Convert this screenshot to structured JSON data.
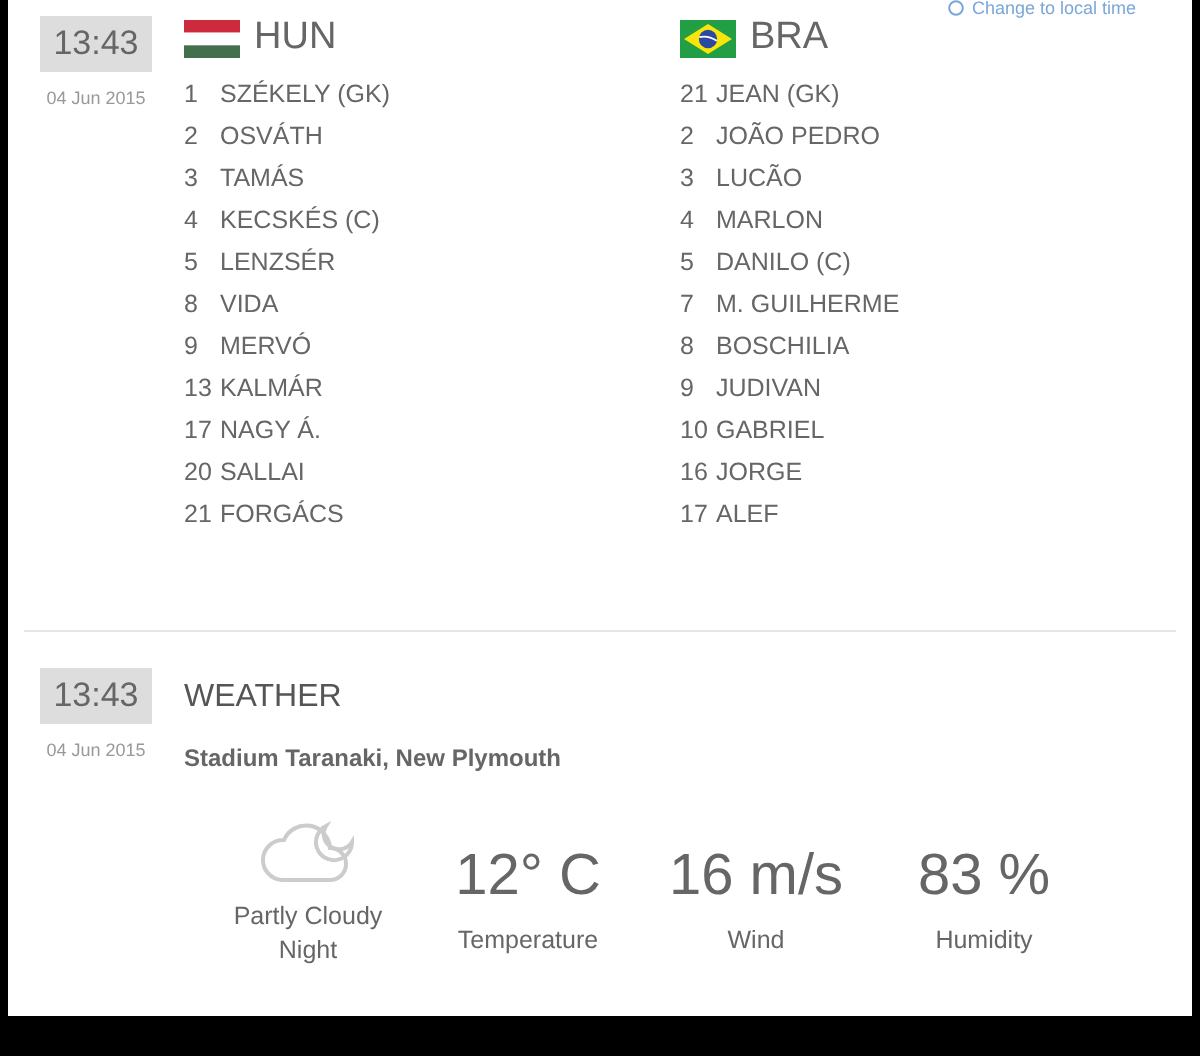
{
  "local_time_link": "Change to local time",
  "lineups": {
    "time": "13:43",
    "date": "04 Jun 2015",
    "teams": [
      {
        "code": "HUN",
        "kind": "hungary",
        "players": [
          {
            "number": "1",
            "name": "SZÉKELY (GK)"
          },
          {
            "number": "2",
            "name": "OSVÁTH"
          },
          {
            "number": "3",
            "name": "TAMÁS"
          },
          {
            "number": "4",
            "name": "KECSKÉS (C)"
          },
          {
            "number": "5",
            "name": "LENZSÉR"
          },
          {
            "number": "8",
            "name": "VIDA"
          },
          {
            "number": "9",
            "name": "MERVÓ"
          },
          {
            "number": "13",
            "name": "KALMÁR"
          },
          {
            "number": "17",
            "name": "NAGY Á."
          },
          {
            "number": "20",
            "name": "SALLAI"
          },
          {
            "number": "21",
            "name": "FORGÁCS"
          }
        ]
      },
      {
        "code": "BRA",
        "kind": "brazil",
        "players": [
          {
            "number": "21",
            "name": "JEAN (GK)"
          },
          {
            "number": "2",
            "name": "JOÃO PEDRO"
          },
          {
            "number": "3",
            "name": "LUCÃO"
          },
          {
            "number": "4",
            "name": "MARLON"
          },
          {
            "number": "5",
            "name": "DANILO (C)"
          },
          {
            "number": "7",
            "name": "M. GUILHERME"
          },
          {
            "number": "8",
            "name": "BOSCHILIA"
          },
          {
            "number": "9",
            "name": "JUDIVAN"
          },
          {
            "number": "10",
            "name": "GABRIEL"
          },
          {
            "number": "16",
            "name": "JORGE"
          },
          {
            "number": "17",
            "name": "ALEF"
          }
        ]
      }
    ]
  },
  "weather": {
    "time": "13:43",
    "date": "04 Jun 2015",
    "title": "WEATHER",
    "venue": "Stadium Taranaki, New Plymouth",
    "condition": "Partly Cloudy Night",
    "stats": [
      {
        "value": "12° C",
        "label": "Temperature"
      },
      {
        "value": "16 m/s",
        "label": "Wind"
      },
      {
        "value": "83 %",
        "label": "Humidity"
      }
    ]
  }
}
